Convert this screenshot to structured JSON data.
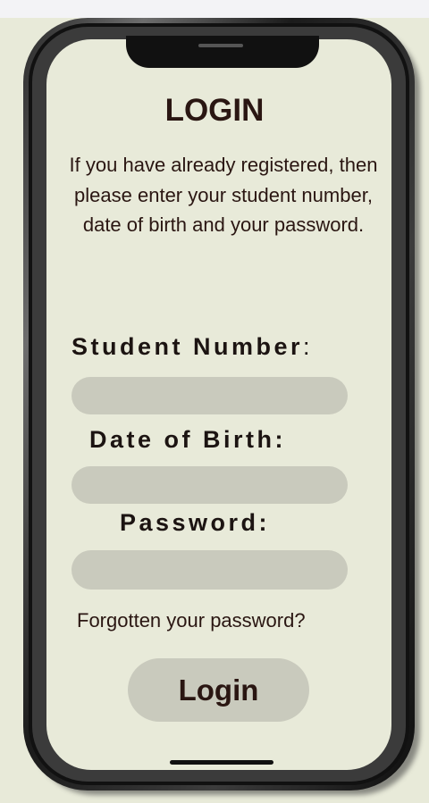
{
  "screen": {
    "title": "LOGIN",
    "description": "If you have already registered, then please enter your student number, date of birth and your password.",
    "fields": {
      "student_number_label": "Student Number",
      "student_number_colon": ":",
      "dob_label": "Date of Birth:",
      "password_label": "Password:"
    },
    "forgot_link": "Forgotten your password?",
    "login_button": "Login"
  },
  "colors": {
    "background": "#e8ead9",
    "field_fill": "#c9cabd",
    "text": "#2a1612"
  }
}
